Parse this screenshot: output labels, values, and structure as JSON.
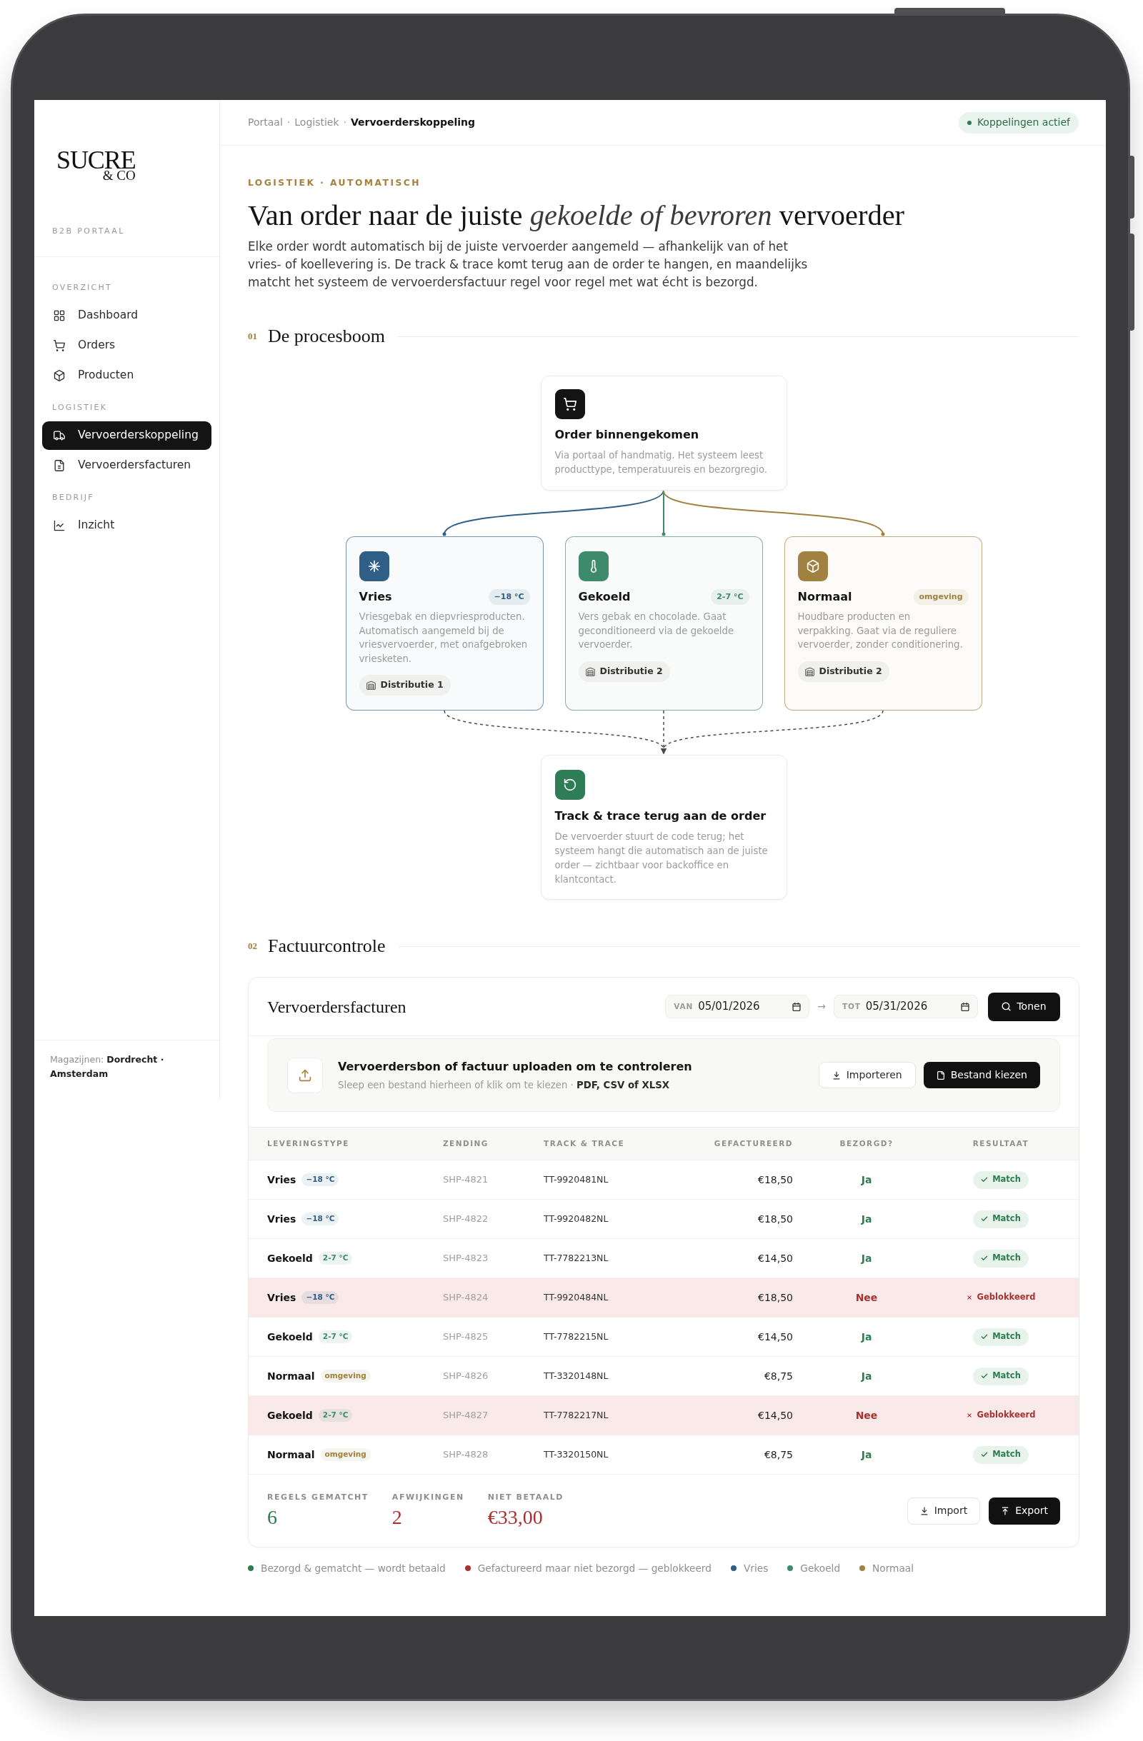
{
  "sidebar": {
    "logo": {
      "name": "SUCRE",
      "suffix": "& CO"
    },
    "subtitle": "B2B PORTAAL",
    "groups": [
      {
        "label": "OVERZICHT",
        "items": [
          {
            "label": "Dashboard",
            "selected": false
          },
          {
            "label": "Orders",
            "selected": false
          },
          {
            "label": "Producten",
            "selected": false
          }
        ]
      },
      {
        "label": "LOGISTIEK",
        "items": [
          {
            "label": "Vervoerderskoppeling",
            "selected": true
          },
          {
            "label": "Vervoerdersfacturen",
            "selected": false
          }
        ]
      },
      {
        "label": "BEDRIJF",
        "items": [
          {
            "label": "Inzicht",
            "selected": false
          }
        ]
      }
    ],
    "footer": "Magazijnen: **Dordrecht · Amsterdam**"
  },
  "topbar": {
    "breadcrumb": {
      "separator": "·",
      "items": [
        {
          "label": "Portaal",
          "selected": false
        },
        {
          "label": "Logistiek",
          "selected": false
        },
        {
          "label": "Vervoerderskoppeling",
          "selected": true
        }
      ]
    },
    "status": "Koppelingen actief"
  },
  "header": {
    "eyebrow": "LOGISTIEK · AUTOMATISCH",
    "title": "Van order naar de juiste *gekoelde of bevroren* vervoerder",
    "intro": "Elke order wordt automatisch bij de juiste vervoerder aangemeld — afhankelijk van of het vries- of koellevering is. De track & trace komt terug aan de order te hangen, en maandelijks matcht het systeem de vervoerdersfactuur regel voor regel met wat écht is bezorgd."
  },
  "process_section": {
    "number": "01",
    "title": "De procesboom",
    "start": {
      "title": "Order binnengekomen",
      "description": "Via portaal of handmatig. Het systeem leest producttype, temperatuureis en bezorgregio."
    },
    "branches": [
      {
        "title": "Vries",
        "badge": "−18 °C",
        "description": "Vriesgebak en diepvriesproducten. Automatisch aangemeld bij de vriesvervoerder, met onafgebroken vriesketen.",
        "location": "Distributie 1",
        "color": "#2f5f86"
      },
      {
        "title": "Gekoeld",
        "badge": "2-7 °C",
        "description": "Vers gebak en chocolade. Gaat geconditioneerd via de gekoelde vervoerder.",
        "location": "Distributie 2",
        "color": "#3d8a6d"
      },
      {
        "title": "Normaal",
        "badge": "omgeving",
        "description": "Houdbare producten en verpakking. Gaat via de reguliere vervoerder, zonder conditionering.",
        "location": "Distributie 2",
        "color": "#a0813f"
      }
    ],
    "end": {
      "title": "Track & trace terug aan de order",
      "description": "De vervoerder stuurt de code terug; het systeem hangt die automatisch aan de juiste order — zichtbaar voor backoffice en klantcontact."
    }
  },
  "invoice_section": {
    "number": "02",
    "title": "Factuurcontrole",
    "card": {
      "title": "Vervoerdersfacturen",
      "filters": [
        {
          "label": "VAN",
          "value": "05/01/2026"
        },
        {
          "label": "TOT",
          "value": "05/31/2026"
        }
      ],
      "range_separator": "→",
      "submit": "Tonen",
      "upload": {
        "title": "Vervoerdersbon of factuur uploaden om te controleren",
        "hint": "Sleep een bestand hierheen of klik om te kiezen · **PDF, CSV of XLSX**",
        "buttons": [
          {
            "label": "Importeren",
            "kind": "secondary"
          },
          {
            "label": "Bestand kiezen",
            "kind": "primary"
          }
        ]
      },
      "table": {
        "columns": [
          "LEVERINGSTYPE",
          "ZENDING",
          "TRACK & TRACE",
          "GEFACTUREERD",
          "BEZORGD?",
          "RESULTAAT"
        ],
        "rows": [
          {
            "type": "Vries",
            "temp": {
              "text": "−18 °C",
              "color": "#2f5f86"
            },
            "shipment": "SHP-4821",
            "tracking": "TT-9920481NL",
            "invoiced": "€18,50",
            "delivered": "Ja",
            "result": "Match",
            "blocked": false
          },
          {
            "type": "Vries",
            "temp": {
              "text": "−18 °C",
              "color": "#2f5f86"
            },
            "shipment": "SHP-4822",
            "tracking": "TT-9920482NL",
            "invoiced": "€18,50",
            "delivered": "Ja",
            "result": "Match",
            "blocked": false
          },
          {
            "type": "Gekoeld",
            "temp": {
              "text": "2-7 °C",
              "color": "#3d8a6d"
            },
            "shipment": "SHP-4823",
            "tracking": "TT-7782213NL",
            "invoiced": "€14,50",
            "delivered": "Ja",
            "result": "Match",
            "blocked": false
          },
          {
            "type": "Vries",
            "temp": {
              "text": "−18 °C",
              "color": "#2f5f86"
            },
            "shipment": "SHP-4824",
            "tracking": "TT-9920484NL",
            "invoiced": "€18,50",
            "delivered": "Nee",
            "result": "Geblokkeerd",
            "blocked": true
          },
          {
            "type": "Gekoeld",
            "temp": {
              "text": "2-7 °C",
              "color": "#3d8a6d"
            },
            "shipment": "SHP-4825",
            "tracking": "TT-7782215NL",
            "invoiced": "€14,50",
            "delivered": "Ja",
            "result": "Match",
            "blocked": false
          },
          {
            "type": "Normaal",
            "temp": {
              "text": "omgeving",
              "color": "#a0813f"
            },
            "shipment": "SHP-4826",
            "tracking": "TT-3320148NL",
            "invoiced": "€8,75",
            "delivered": "Ja",
            "result": "Match",
            "blocked": false
          },
          {
            "type": "Gekoeld",
            "temp": {
              "text": "2-7 °C",
              "color": "#3d8a6d"
            },
            "shipment": "SHP-4827",
            "tracking": "TT-7782217NL",
            "invoiced": "€14,50",
            "delivered": "Nee",
            "result": "Geblokkeerd",
            "blocked": true
          },
          {
            "type": "Normaal",
            "temp": {
              "text": "omgeving",
              "color": "#a0813f"
            },
            "shipment": "SHP-4828",
            "tracking": "TT-3320150NL",
            "invoiced": "€8,75",
            "delivered": "Ja",
            "result": "Match",
            "blocked": false
          }
        ]
      },
      "summary": {
        "stats": [
          {
            "label": "REGELS GEMATCHT",
            "value": "6",
            "color": "#2e7d4f"
          },
          {
            "label": "AFWIJKINGEN",
            "value": "2",
            "color": "#a83232"
          },
          {
            "label": "NIET BETAALD",
            "value": "€33,00",
            "color": "#a83232"
          }
        ],
        "buttons": [
          {
            "label": "Import",
            "kind": "secondary"
          },
          {
            "label": "Export",
            "kind": "primary"
          }
        ]
      }
    }
  },
  "legend": [
    {
      "label": "Bezorgd & gematcht — wordt betaald",
      "color": "#2e7d4f"
    },
    {
      "label": "Gefactureerd maar niet bezorgd — geblokkeerd",
      "color": "#a83232"
    },
    {
      "label": "Vries",
      "color": "#2f5f86"
    },
    {
      "label": "Gekoeld",
      "color": "#3d8a6d"
    },
    {
      "label": "Normaal",
      "color": "#a0813f"
    }
  ]
}
